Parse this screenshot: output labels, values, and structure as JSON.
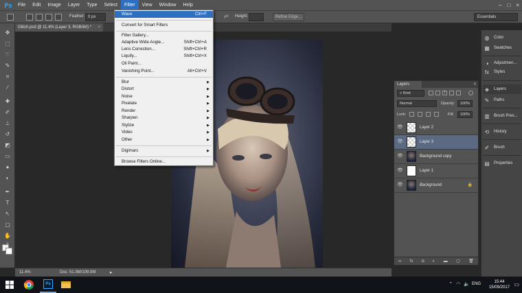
{
  "app": {
    "logo": "Ps",
    "window_controls": [
      "–",
      "□",
      "×"
    ]
  },
  "menu": {
    "items": [
      "File",
      "Edit",
      "Image",
      "Layer",
      "Type",
      "Select",
      "Filter",
      "View",
      "Window",
      "Help"
    ],
    "active": "Filter"
  },
  "options_bar": {
    "feather_label": "Feather:",
    "feather_value": "0 px",
    "height_label": "Height:",
    "refine_edge_label": "Refine Edge...",
    "workspace": "Essentials"
  },
  "document": {
    "tab_title": "Glitch.psd @ 11.4% (Layer 3, RGB/8#) *",
    "tab_close": "×",
    "zoom": "11.4%",
    "doc_size": "Doc: 51.3M/109.0M",
    "status_arrow": "▸"
  },
  "filter_menu": {
    "items": [
      {
        "label": "Wave",
        "shortcut": "Ctrl+F",
        "highlight": true
      },
      {
        "label": "Convert for Smart Filters"
      },
      {
        "label": "Filter Gallery..."
      },
      {
        "label": "Adaptive Wide Angle...",
        "shortcut": "Shift+Ctrl+A"
      },
      {
        "label": "Lens Correction...",
        "shortcut": "Shift+Ctrl+R"
      },
      {
        "label": "Liquify...",
        "shortcut": "Shift+Ctrl+X"
      },
      {
        "label": "Oil Paint..."
      },
      {
        "label": "Vanishing Point...",
        "shortcut": "Alt+Ctrl+V"
      },
      {
        "label": "Blur",
        "submenu": true
      },
      {
        "label": "Distort",
        "submenu": true
      },
      {
        "label": "Noise",
        "submenu": true
      },
      {
        "label": "Pixelate",
        "submenu": true
      },
      {
        "label": "Render",
        "submenu": true
      },
      {
        "label": "Sharpen",
        "submenu": true
      },
      {
        "label": "Stylize",
        "submenu": true
      },
      {
        "label": "Video",
        "submenu": true
      },
      {
        "label": "Other",
        "submenu": true
      },
      {
        "label": "Digimarc",
        "submenu": true
      },
      {
        "label": "Browse Filters Online..."
      }
    ]
  },
  "right_panels": {
    "items": [
      "Color",
      "Swatches",
      "Adjustmen...",
      "Styles",
      "Layers",
      "Paths",
      "Brush Pres...",
      "History",
      "Brush",
      "Properties"
    ],
    "active": "Layers"
  },
  "layers_panel": {
    "tab": "Layers",
    "close": "≡",
    "kind_label": "Kind",
    "blend_mode": "Normal",
    "opacity_label": "Opacity:",
    "opacity_value": "100%",
    "lock_label": "Lock:",
    "fill_label": "Fill:",
    "fill_value": "100%",
    "layers": [
      {
        "name": "Layer 2",
        "thumb": "checker",
        "selected": false,
        "italic": false,
        "locked": false
      },
      {
        "name": "Layer 3",
        "thumb": "checker",
        "selected": true,
        "italic": false,
        "locked": false
      },
      {
        "name": "Background copy",
        "thumb": "photo",
        "selected": false,
        "italic": false,
        "locked": false
      },
      {
        "name": "Layer 1",
        "thumb": "white",
        "selected": false,
        "italic": false,
        "locked": false
      },
      {
        "name": "Background",
        "thumb": "photo",
        "selected": false,
        "italic": true,
        "locked": true
      }
    ],
    "footer_icons": [
      "link-icon",
      "fx-icon",
      "mask-icon",
      "adjustment-icon",
      "folder-icon",
      "new-layer-icon",
      "trash-icon"
    ]
  },
  "taskbar": {
    "language": "ENG",
    "time": "15:44",
    "date": "15/09/2017"
  }
}
